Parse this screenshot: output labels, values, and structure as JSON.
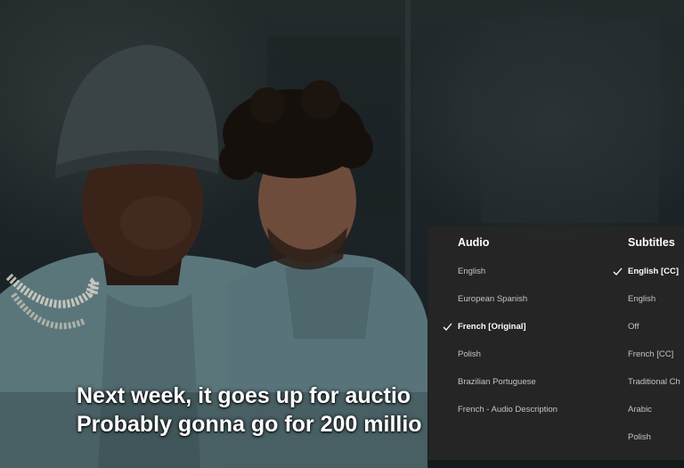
{
  "subtitle": {
    "line1": "Next week, it goes up for auctio",
    "line2": "Probably gonna go for 200 millio"
  },
  "audio_subtitles_menu": {
    "audio": {
      "heading": "Audio",
      "options": [
        {
          "label": "English"
        },
        {
          "label": "European Spanish"
        },
        {
          "label": "French [Original]",
          "selected": true
        },
        {
          "label": "Polish"
        },
        {
          "label": "Brazilian Portuguese"
        },
        {
          "label": "French - Audio Description"
        }
      ]
    },
    "subtitles": {
      "heading": "Subtitles",
      "options": [
        {
          "label": "English [CC]",
          "selected": true
        },
        {
          "label": "English"
        },
        {
          "label": "Off"
        },
        {
          "label": "French [CC]"
        },
        {
          "label": "Traditional Ch"
        },
        {
          "label": "Arabic"
        },
        {
          "label": "Polish"
        }
      ]
    },
    "check_icon": "check-icon",
    "colors": {
      "panel_bg": "#262626",
      "selected_text": "#ffffff",
      "option_text": "#c4c4c4"
    }
  }
}
